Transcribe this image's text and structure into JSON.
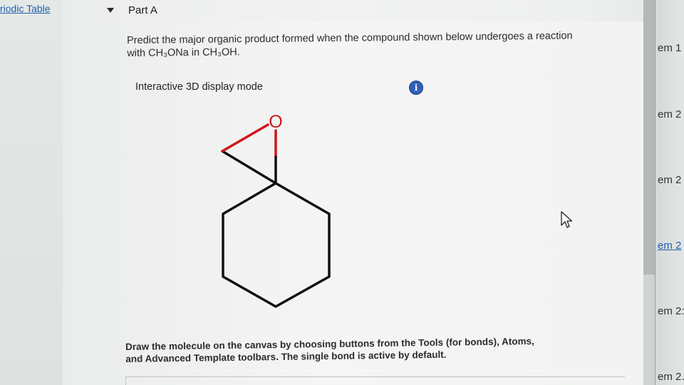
{
  "sidebar": {
    "periodic_table_link": "riodic Table"
  },
  "part": {
    "title": "Part A"
  },
  "question": {
    "line1": "Predict the major organic product formed when the compound shown below undergoes a reaction",
    "line2": "with CH₃ONa in CH₃OH."
  },
  "display_mode": {
    "label": "Interactive 3D display mode",
    "info_glyph": "i"
  },
  "molecule": {
    "oxygen_label": "O",
    "bond_color": "#111111",
    "oxygen_color": "#d0161b"
  },
  "instructions": {
    "line1": "Draw the molecule on the canvas by choosing buttons from the Tools (for bonds), Atoms,",
    "line2": "and Advanced Template toolbars. The single bond is active by default."
  },
  "right_items": [
    {
      "label": "em 1"
    },
    {
      "label": "em 2"
    },
    {
      "label": "em 2"
    },
    {
      "label": "em 2"
    },
    {
      "label": "em 2:"
    },
    {
      "label": "em 2…"
    }
  ]
}
